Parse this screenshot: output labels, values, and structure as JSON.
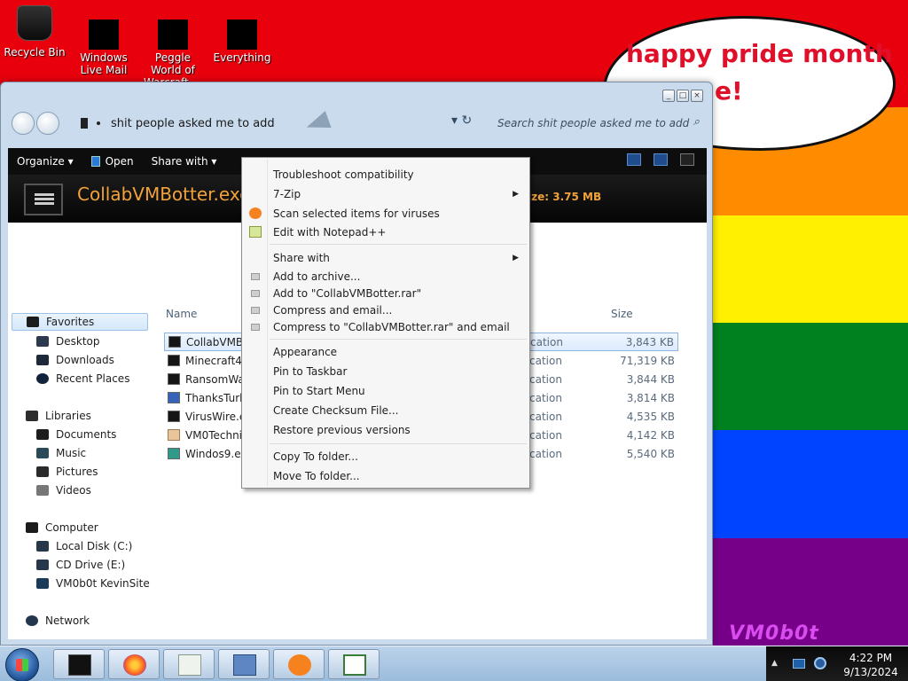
{
  "desktop": {
    "icons": [
      {
        "label": "Recycle Bin"
      },
      {
        "label": "Windows Live Mail"
      },
      {
        "label": "Peggle World of Warcraft ..."
      },
      {
        "label": "Everything"
      }
    ],
    "bubble_line1": "happy pride month",
    "bubble_line2": "e!",
    "watermark": "VM0b0t",
    "stripes": [
      "#e8000d",
      "#ff8c00",
      "#ffef00",
      "#00811f",
      "#0044ff",
      "#760088"
    ]
  },
  "explorer": {
    "address": "shit people asked me to add",
    "search_placeholder": "Search shit people asked me to add",
    "toolbar": {
      "organize": "Organize ▾",
      "open": "Open",
      "share_with": "Share with ▾"
    },
    "details": {
      "title": "CollabVMBotter.exe",
      "size": "ize: 3.75 MB"
    },
    "nav": {
      "favorites": "Favorites",
      "desktop": "Desktop",
      "downloads": "Downloads",
      "recent_places": "Recent Places",
      "libraries": "Libraries",
      "documents": "Documents",
      "music": "Music",
      "pictures": "Pictures",
      "videos": "Videos",
      "computer": "Computer",
      "local_disk": "Local Disk (C:)",
      "cd_drive": "CD Drive (E:)",
      "vm_site": "VM0b0t KevinSite",
      "network": "Network"
    },
    "columns": {
      "name": "Name",
      "size": "Size"
    },
    "files": [
      {
        "name": "CollabVMBo",
        "type": "cation",
        "size": "3,843 KB"
      },
      {
        "name": "Minecraft4Fr",
        "type": "cation",
        "size": "71,319 KB"
      },
      {
        "name": "RansomWar",
        "type": "cation",
        "size": "3,844 KB"
      },
      {
        "name": "ThanksTurke",
        "type": "cation",
        "size": "3,814 KB"
      },
      {
        "name": "VirusWire.exe",
        "type": "cation",
        "size": "4,535 KB"
      },
      {
        "name": "VM0Technic",
        "type": "cation",
        "size": "4,142 KB"
      },
      {
        "name": "Windos9.exe",
        "type": "cation",
        "size": "5,540 KB"
      }
    ]
  },
  "context_menu": {
    "troubleshoot": "Troubleshoot compatibility",
    "seven_zip": "7-Zip",
    "scan": "Scan selected items for viruses",
    "edit_npp": "Edit with Notepad++",
    "share_with": "Share with",
    "add_archive": "Add to archive...",
    "add_rar": "Add to \"CollabVMBotter.rar\"",
    "compress_email": "Compress and email...",
    "compress_rar_email": "Compress to \"CollabVMBotter.rar\" and email",
    "appearance": "Appearance",
    "pin_taskbar": "Pin to Taskbar",
    "pin_start": "Pin to Start Menu",
    "checksum": "Create Checksum File...",
    "restore": "Restore previous versions",
    "copy_to": "Copy To folder...",
    "move_to": "Move To folder..."
  },
  "taskbar": {
    "time": "4:22 PM",
    "date": "9/13/2024"
  }
}
